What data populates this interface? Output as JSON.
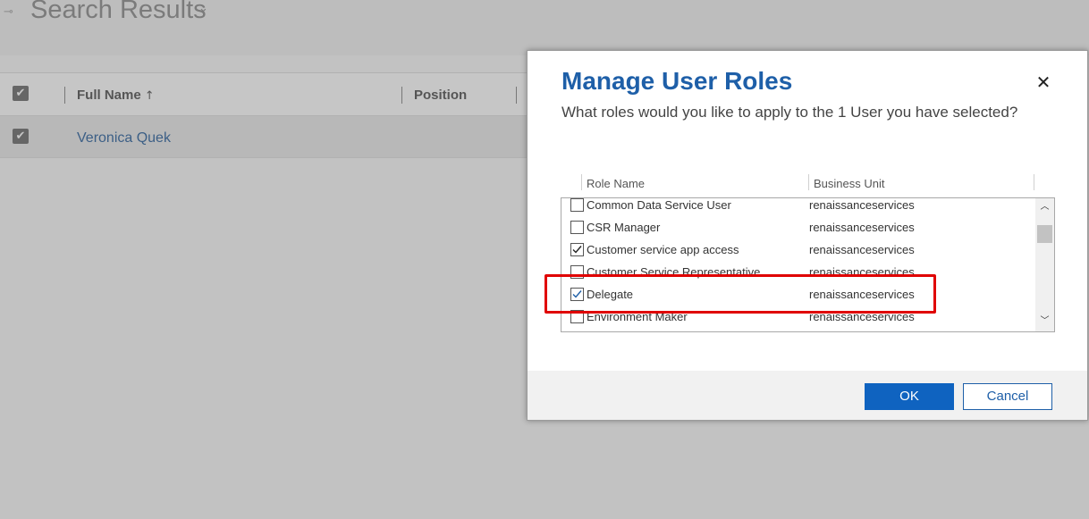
{
  "background": {
    "title": "Search Results",
    "grid": {
      "columns": [
        "Full Name",
        "Position"
      ],
      "rows": [
        {
          "full_name": "Veronica Quek"
        }
      ]
    }
  },
  "dialog": {
    "title": "Manage User Roles",
    "subtitle": "What roles would you like to apply to the 1 User you have selected?",
    "columns": {
      "role_name": "Role Name",
      "business_unit": "Business Unit"
    },
    "roles": [
      {
        "name": "Common Data Service User",
        "business_unit": "renaissanceservices",
        "checked": false
      },
      {
        "name": "CSR Manager",
        "business_unit": "renaissanceservices",
        "checked": false
      },
      {
        "name": "Customer service app access",
        "business_unit": "renaissanceservices",
        "checked": true
      },
      {
        "name": "Customer Service Representative",
        "business_unit": "renaissanceservices",
        "checked": false
      },
      {
        "name": "Delegate",
        "business_unit": "renaissanceservices",
        "checked": true
      },
      {
        "name": "Environment Maker",
        "business_unit": "renaissanceservices",
        "checked": false
      }
    ],
    "buttons": {
      "ok": "OK",
      "cancel": "Cancel"
    }
  },
  "colors": {
    "accent": "#1e5fa8",
    "primary_button": "#0f63c0",
    "highlight": "#e00000"
  },
  "icons": {
    "pin": "pin-icon",
    "title_dropdown": "chevron-down-icon",
    "sort": "arrow-up-icon",
    "close": "close-icon",
    "scroll_up": "chevron-up-icon",
    "scroll_down": "chevron-down-icon"
  }
}
